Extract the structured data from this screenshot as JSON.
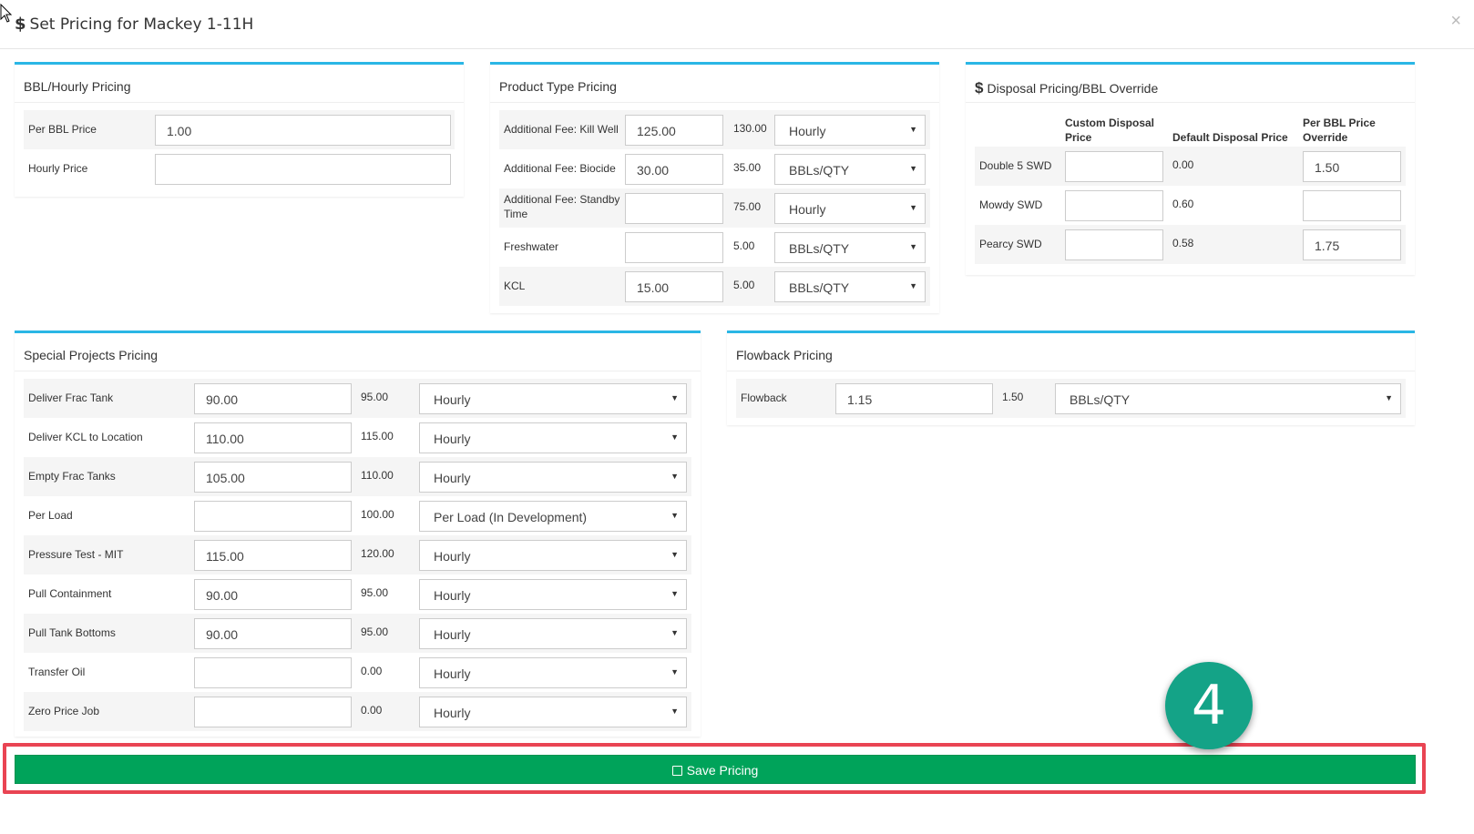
{
  "modal": {
    "currency_symbol": "$",
    "title": "Set Pricing for Mackey 1-11H",
    "close_label": "×"
  },
  "bbl_hourly": {
    "title": "BBL/Hourly Pricing",
    "rows": [
      {
        "label": "Per BBL Price",
        "value": "1.00"
      },
      {
        "label": "Hourly Price",
        "value": ""
      }
    ]
  },
  "product_type": {
    "title": "Product Type Pricing",
    "rows": [
      {
        "label": "Additional Fee: Kill Well",
        "value": "125.00",
        "default": "130.00",
        "unit": "Hourly"
      },
      {
        "label": "Additional Fee: Biocide",
        "value": "30.00",
        "default": "35.00",
        "unit": "BBLs/QTY"
      },
      {
        "label": "Additional Fee: Standby Time",
        "value": "",
        "default": "75.00",
        "unit": "Hourly"
      },
      {
        "label": "Freshwater",
        "value": "",
        "default": "5.00",
        "unit": "BBLs/QTY"
      },
      {
        "label": "KCL",
        "value": "15.00",
        "default": "5.00",
        "unit": "BBLs/QTY"
      }
    ]
  },
  "disposal": {
    "currency_symbol": "$",
    "title": "Disposal Pricing/BBL Override",
    "headers": {
      "custom": "Custom Disposal Price",
      "default": "Default Disposal Price",
      "override": "Per BBL Price Override"
    },
    "rows": [
      {
        "label": "Double 5 SWD",
        "custom": "",
        "default": "0.00",
        "override": "1.50"
      },
      {
        "label": "Mowdy SWD",
        "custom": "",
        "default": "0.60",
        "override": ""
      },
      {
        "label": "Pearcy SWD",
        "custom": "",
        "default": "0.58",
        "override": "1.75"
      }
    ]
  },
  "special_projects": {
    "title": "Special Projects Pricing",
    "rows": [
      {
        "label": "Deliver Frac Tank",
        "value": "90.00",
        "default": "95.00",
        "unit": "Hourly"
      },
      {
        "label": "Deliver KCL to Location",
        "value": "110.00",
        "default": "115.00",
        "unit": "Hourly"
      },
      {
        "label": "Empty Frac Tanks",
        "value": "105.00",
        "default": "110.00",
        "unit": "Hourly"
      },
      {
        "label": "Per Load",
        "value": "",
        "default": "100.00",
        "unit": "Per Load (In Development)"
      },
      {
        "label": "Pressure Test - MIT",
        "value": "115.00",
        "default": "120.00",
        "unit": "Hourly"
      },
      {
        "label": "Pull Containment",
        "value": "90.00",
        "default": "95.00",
        "unit": "Hourly"
      },
      {
        "label": "Pull Tank Bottoms",
        "value": "90.00",
        "default": "95.00",
        "unit": "Hourly"
      },
      {
        "label": "Transfer Oil",
        "value": "",
        "default": "0.00",
        "unit": "Hourly"
      },
      {
        "label": "Zero Price Job",
        "value": "",
        "default": "0.00",
        "unit": "Hourly"
      }
    ]
  },
  "flowback": {
    "title": "Flowback Pricing",
    "rows": [
      {
        "label": "Flowback",
        "value": "1.15",
        "default": "1.50",
        "unit": "BBLs/QTY"
      }
    ]
  },
  "save_button": {
    "label": "Save Pricing"
  },
  "step_badge": {
    "number": "4"
  },
  "colors": {
    "panel_accent": "#2ab6e5",
    "save_green": "#00a35a",
    "highlight_red": "#e94453",
    "badge_teal": "#14a387"
  }
}
